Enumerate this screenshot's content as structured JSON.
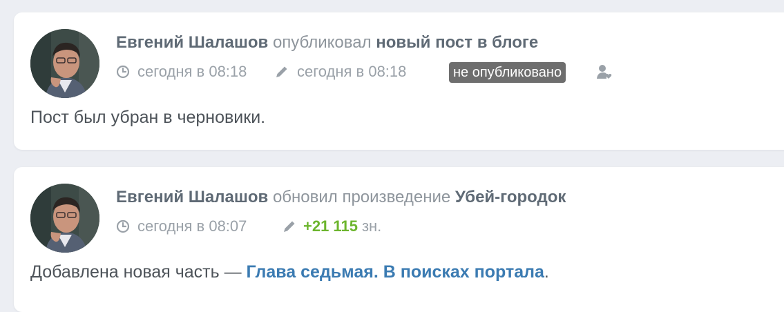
{
  "feed": [
    {
      "author": "Евгений Шалашов",
      "action": "опубликовал",
      "target": "новый пост в блоге",
      "created": "сегодня в 08:18",
      "edited": "сегодня в 08:18",
      "badge": "не опубликовано",
      "text": "Пост был убран в черновики."
    },
    {
      "author": "Евгений Шалашов",
      "action": "обновил произведение",
      "target": "Убей-городок",
      "created": "сегодня в 08:07",
      "plus": "+21 115",
      "unit": "зн.",
      "text_prefix": "Добавлена новая часть —",
      "chapter": "Глава седьмая. В поисках портала",
      "text_suffix": "."
    }
  ],
  "colors": {
    "background": "#eceef3",
    "card": "#ffffff",
    "author": "#5f6a75",
    "muted": "#9aa1a8",
    "badge": "#6e6e6e",
    "plus": "#6cb52d",
    "link": "#3b7bb2"
  },
  "icons": [
    "clock-icon",
    "pencil-icon",
    "user-heart-icon"
  ]
}
